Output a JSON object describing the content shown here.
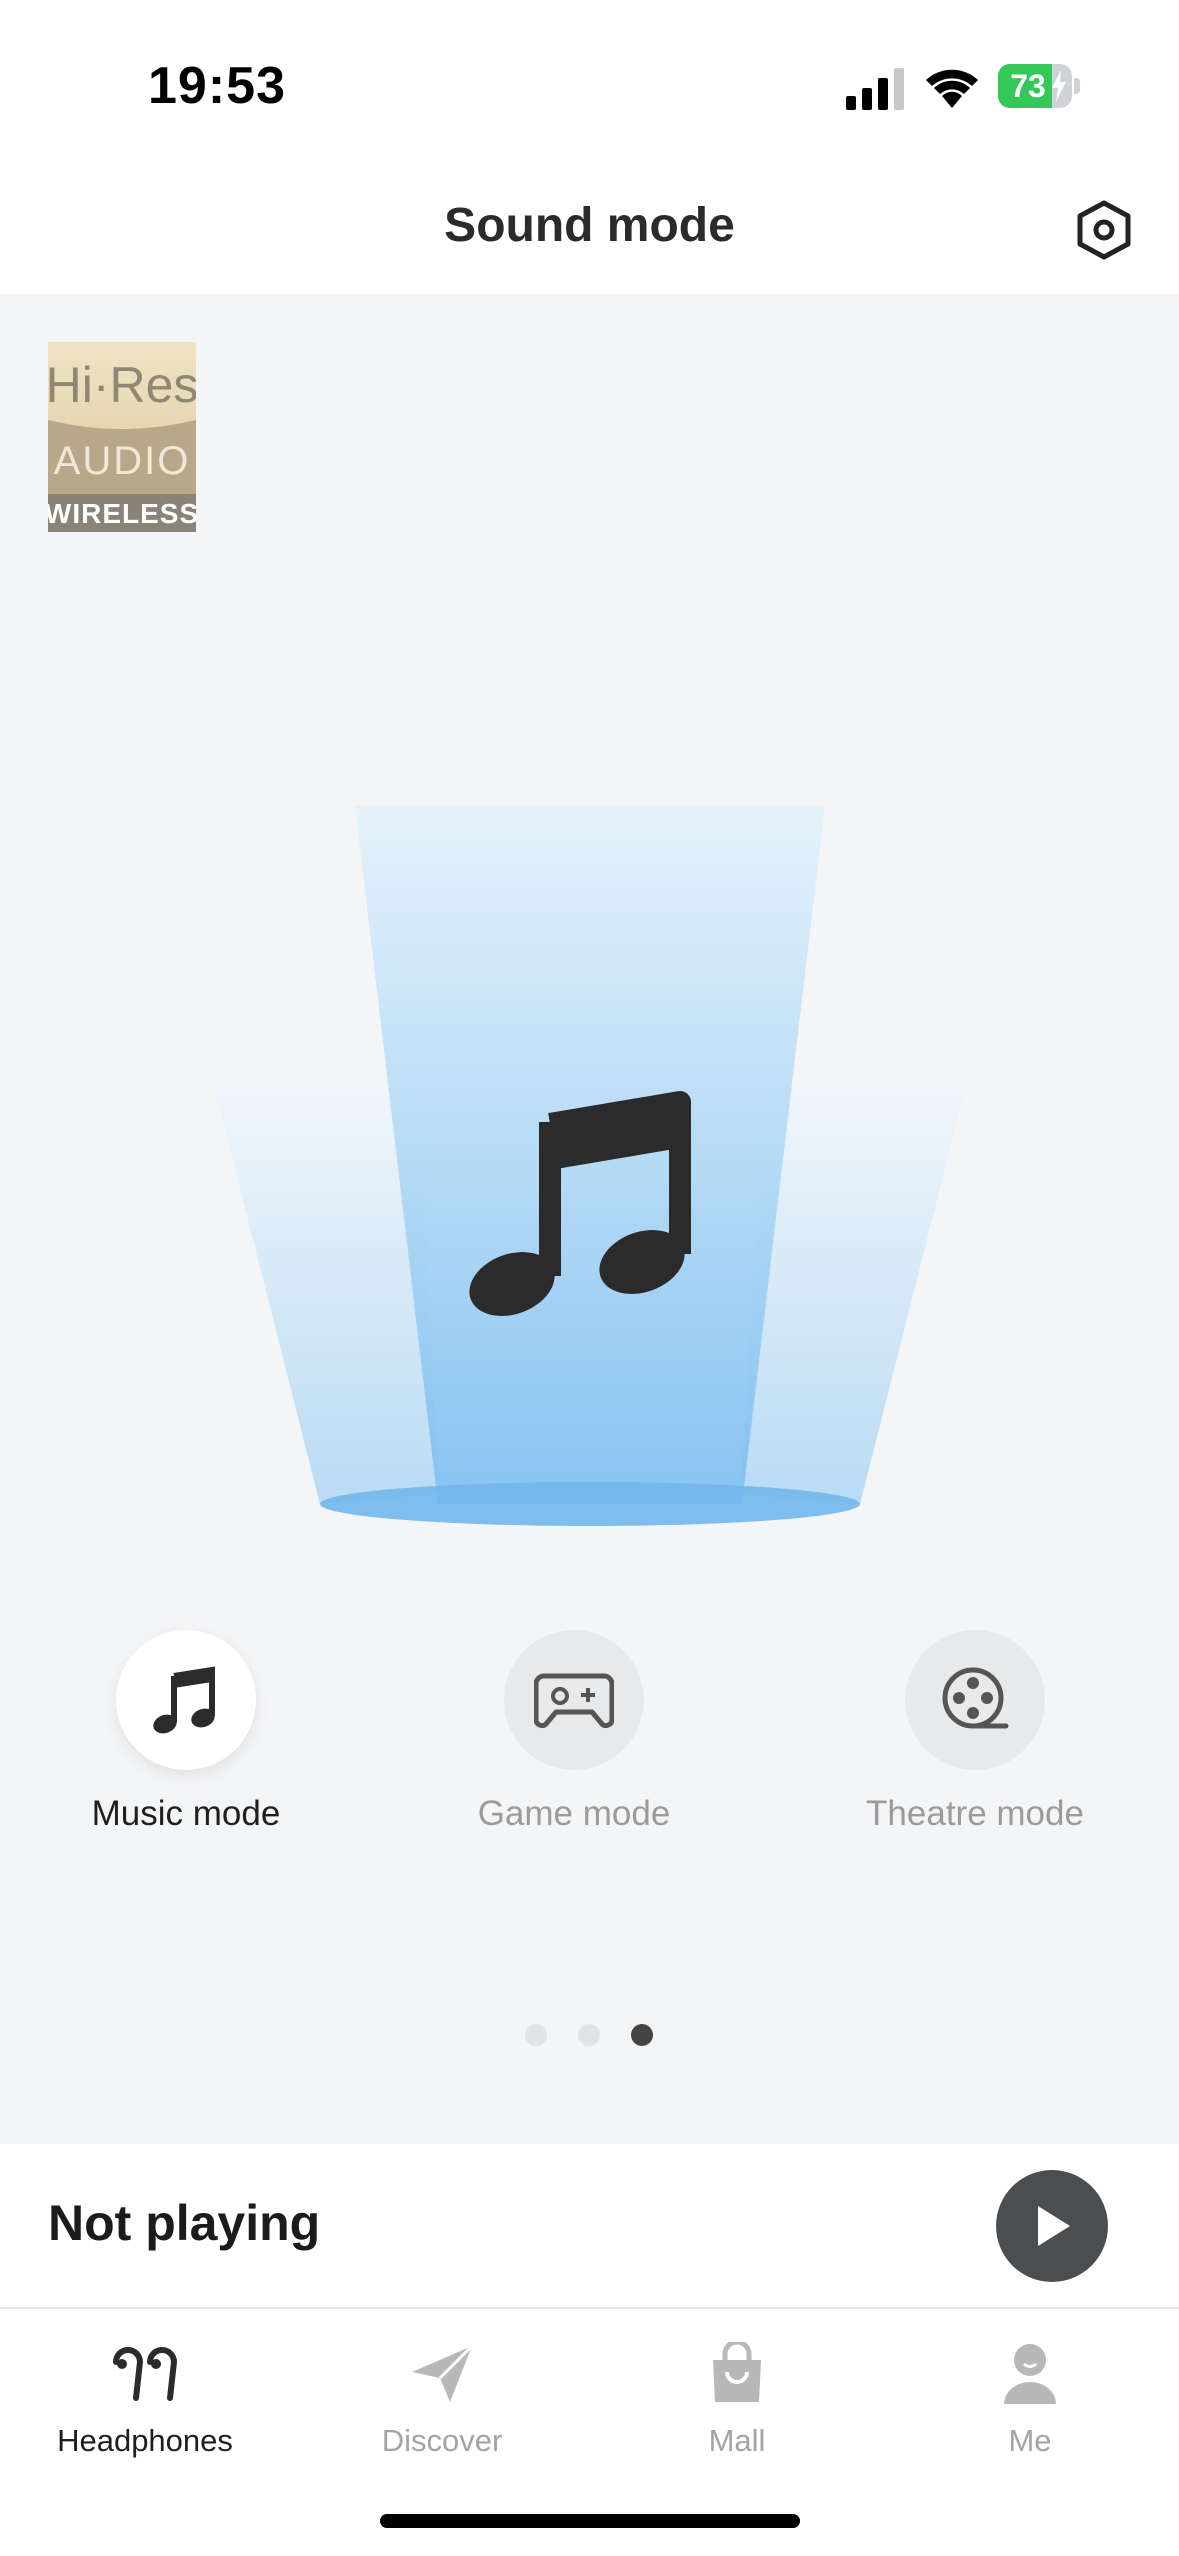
{
  "status_bar": {
    "time": "19:53",
    "battery_percent": "73",
    "battery_level": 0.73,
    "charging": true
  },
  "header": {
    "title": "Sound mode",
    "settings_icon": "settings-hex-icon"
  },
  "badge": {
    "line1": "Hi·Res",
    "line2": "AUDIO",
    "line3": "WIRELESS"
  },
  "hero": {
    "icon": "music-note-icon",
    "accent_color": "#8cc8f0"
  },
  "modes": [
    {
      "label": "Music mode",
      "icon": "music-note-icon",
      "active": true
    },
    {
      "label": "Game mode",
      "icon": "gamepad-icon",
      "active": false
    },
    {
      "label": "Theatre mode",
      "icon": "film-reel-icon",
      "active": false
    }
  ],
  "pager": {
    "count": 3,
    "active_index": 2
  },
  "now_playing": {
    "text": "Not playing",
    "action_icon": "play-icon"
  },
  "tabs": [
    {
      "label": "Headphones",
      "icon": "earbuds-icon",
      "active": true
    },
    {
      "label": "Discover",
      "icon": "paper-plane-icon",
      "active": false
    },
    {
      "label": "Mall",
      "icon": "shopping-bag-icon",
      "active": false
    },
    {
      "label": "Me",
      "icon": "person-icon",
      "active": false
    }
  ]
}
